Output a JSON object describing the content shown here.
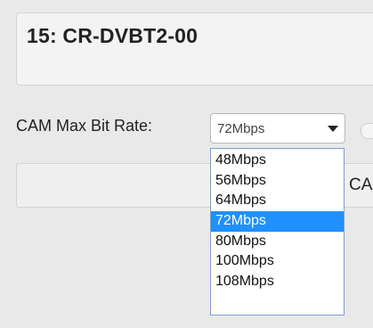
{
  "panel": {
    "title": "15: CR-DVBT2-00"
  },
  "cam_setting": {
    "label": "CAM Max Bit Rate:",
    "selected": "72Mbps",
    "options": [
      "48Mbps",
      "56Mbps",
      "64Mbps",
      "72Mbps",
      "80Mbps",
      "100Mbps",
      "108Mbps"
    ]
  },
  "behind_button": {
    "label": "CA"
  }
}
